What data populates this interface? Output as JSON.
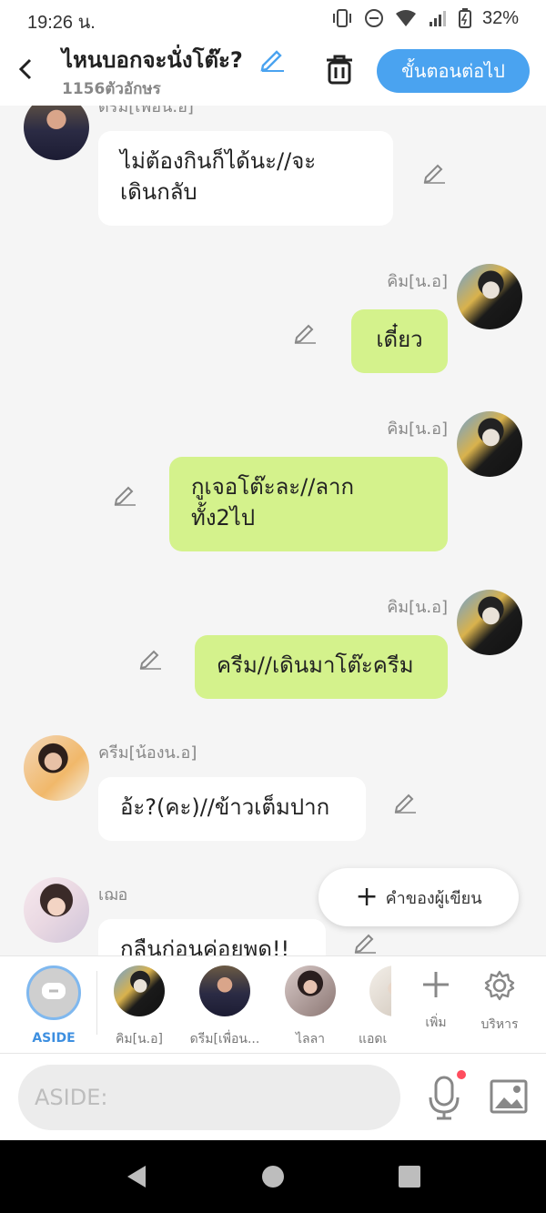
{
  "status": {
    "time": "19:26 น.",
    "battery": "32%"
  },
  "header": {
    "title": "ไหนบอกจะนั่งโต๊ะ?",
    "subtitle": "1156ตัวอักษร",
    "next_label": "ขั้นตอนต่อไป"
  },
  "messages": [
    {
      "name": "ดรีม[เพื่อน.อ]",
      "text_line1": "ไม่ต้องกินก็ได้นะ//จะ",
      "text_line2": "เดินกลับ"
    },
    {
      "name": "คิม[น.อ]",
      "text": "เดี๋ยว"
    },
    {
      "name": "คิม[น.อ]",
      "text_line1": "กูเจอโต๊ะละ//ลาก",
      "text_line2": "ทั้ง2ไป"
    },
    {
      "name": "คิม[น.อ]",
      "text": "ครีม//เดินมาโต๊ะครีม"
    },
    {
      "name": "ครีม[น้องน.อ]",
      "text": "อ้ะ?(คะ)//ข้าวเต็มปาก"
    },
    {
      "name": "เฌอ",
      "text": "กลืนก่อนค่อยพูด!!"
    }
  ],
  "fab": {
    "label": "คำของผู้เขียน"
  },
  "characters": [
    {
      "label": "ASIDE"
    },
    {
      "label": "คิม[น.อ]"
    },
    {
      "label": "ดรีม[เพื่อน..."
    },
    {
      "label": "ไลลา"
    },
    {
      "label": "แอดเ"
    }
  ],
  "tools": {
    "add_label": "เพิ่ม",
    "manage_label": "บริหาร"
  },
  "input": {
    "placeholder": "ASIDE:"
  }
}
